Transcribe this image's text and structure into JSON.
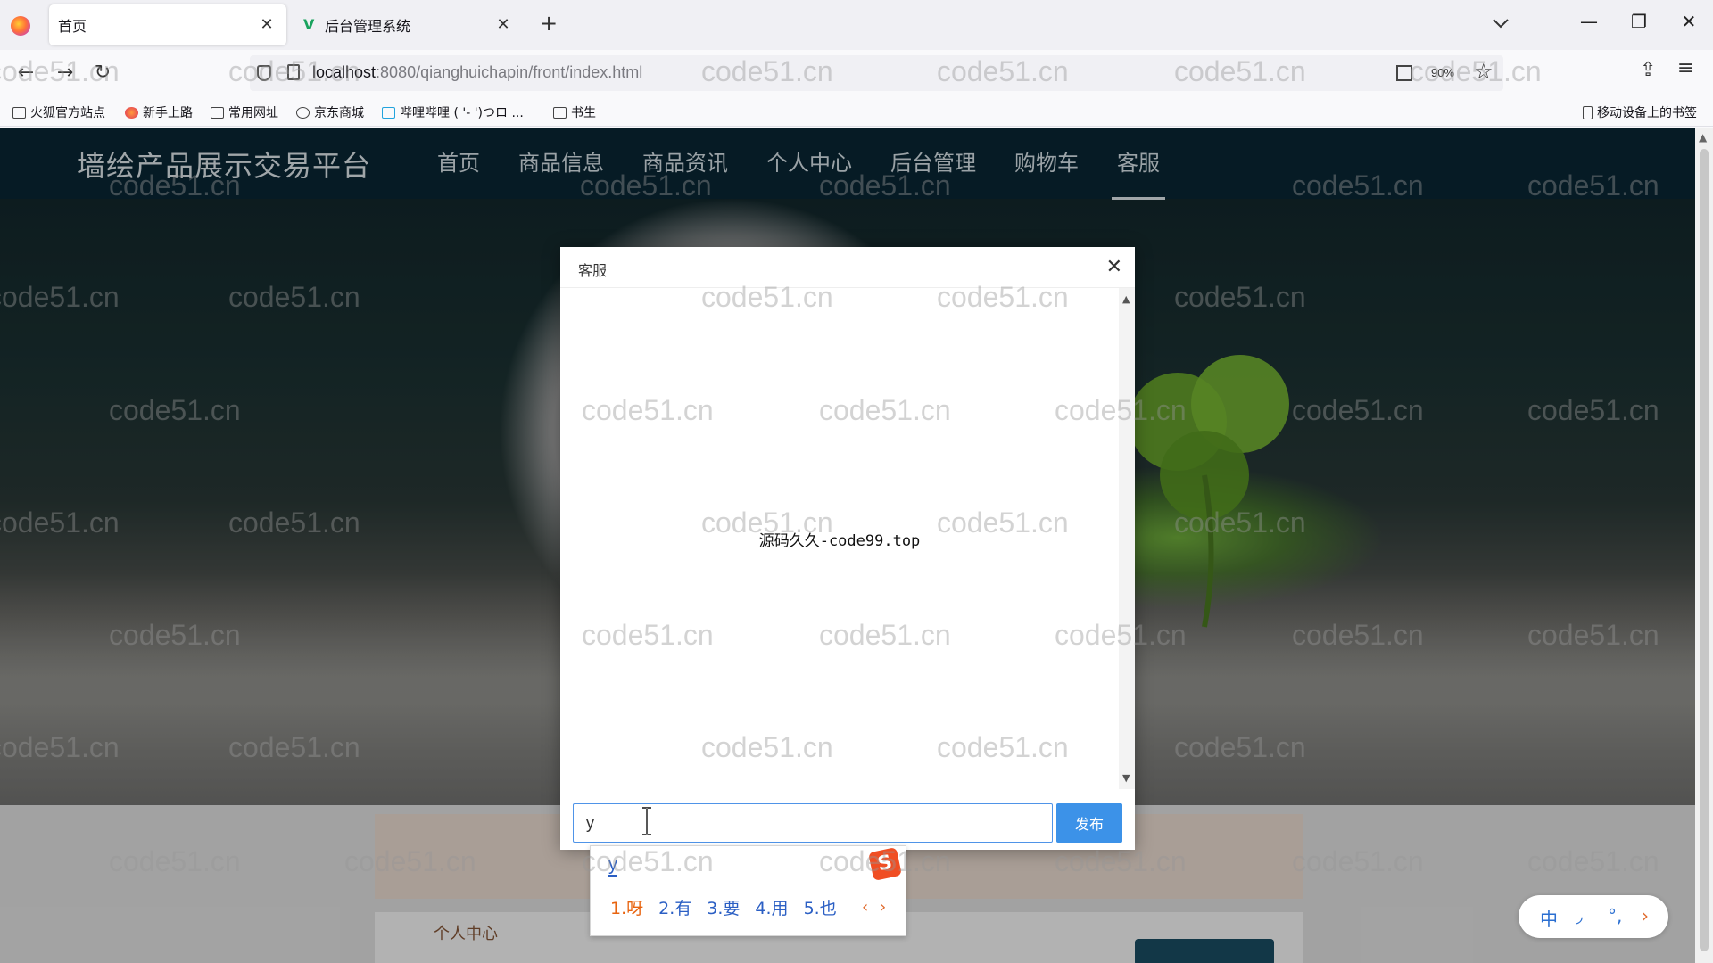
{
  "browser": {
    "tabs": [
      {
        "title": "首页",
        "active": true
      },
      {
        "title": "后台管理系统",
        "active": false
      }
    ],
    "url_host": "localhost",
    "url_path": ":8080/qianghuichapin/front/index.html",
    "zoom": "90%",
    "bookmarks": [
      "火狐官方站点",
      "新手上路",
      "常用网址",
      "京东商城",
      "哔哩哔哩 ( '- ')つロ ...",
      "书生"
    ],
    "mobile_bookmarks": "移动设备上的书签"
  },
  "site": {
    "title": "墙绘产品展示交易平台",
    "nav": [
      {
        "label": "首页"
      },
      {
        "label": "商品信息"
      },
      {
        "label": "商品资讯"
      },
      {
        "label": "个人中心"
      },
      {
        "label": "后台管理"
      },
      {
        "label": "购物车"
      },
      {
        "label": "客服",
        "current": true
      }
    ],
    "lower_label": "个人中心"
  },
  "dialog": {
    "title": "客服",
    "message": "源码久久-code99.top",
    "input_value": "y",
    "send_label": "发布"
  },
  "ime": {
    "composition": "y",
    "logo": "S",
    "candidates": [
      "1.呀",
      "2.有",
      "3.要",
      "4.用",
      "5.也"
    ],
    "toolbar": [
      "中",
      "◞",
      "°,",
      "›"
    ]
  },
  "watermark": "code51.cn"
}
